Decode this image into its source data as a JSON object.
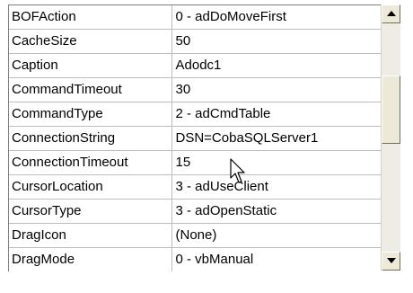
{
  "properties": [
    {
      "name": "BOFAction",
      "value": "0 - adDoMoveFirst"
    },
    {
      "name": "CacheSize",
      "value": "50"
    },
    {
      "name": "Caption",
      "value": "Adodc1"
    },
    {
      "name": "CommandTimeout",
      "value": "30"
    },
    {
      "name": "CommandType",
      "value": "2 - adCmdTable"
    },
    {
      "name": "ConnectionString",
      "value": "DSN=CobaSQLServer1"
    },
    {
      "name": "ConnectionTimeout",
      "value": "15"
    },
    {
      "name": "CursorLocation",
      "value": "3 - adUseClient"
    },
    {
      "name": "CursorType",
      "value": "3 - adOpenStatic"
    },
    {
      "name": "DragIcon",
      "value": "(None)"
    },
    {
      "name": "DragMode",
      "value": "0 - vbManual"
    }
  ],
  "scrollbar": {
    "up_icon": "arrow-up-icon",
    "down_icon": "arrow-down-icon"
  },
  "cursor_icon": "mouse-pointer-icon"
}
